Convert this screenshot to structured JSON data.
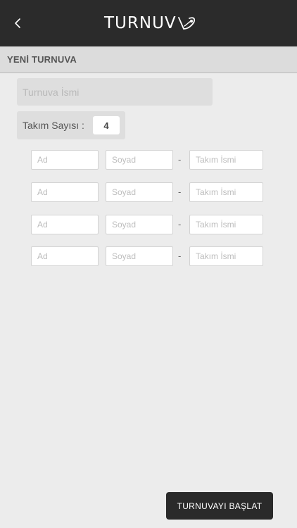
{
  "header": {
    "logo_text": "TURNUV",
    "back_icon": "chevron-left-icon",
    "logo_icon": "ball-swoosh-icon",
    "background_color": "#2b2b2b"
  },
  "section": {
    "title": "YENİ TURNUVA"
  },
  "form": {
    "tournament_name_placeholder": "Turnuva İsmi",
    "team_count_label": "Takım Sayısı :",
    "team_count_value": "4",
    "teams": [
      {
        "first_name_placeholder": "Ad",
        "last_name_placeholder": "Soyad",
        "separator": "-",
        "team_name_placeholder": "Takım İsmi"
      },
      {
        "first_name_placeholder": "Ad",
        "last_name_placeholder": "Soyad",
        "separator": "-",
        "team_name_placeholder": "Takım İsmi"
      },
      {
        "first_name_placeholder": "Ad",
        "last_name_placeholder": "Soyad",
        "separator": "-",
        "team_name_placeholder": "Takım İsmi"
      },
      {
        "first_name_placeholder": "Ad",
        "last_name_placeholder": "Soyad",
        "separator": "-",
        "team_name_placeholder": "Takım İsmi"
      }
    ]
  },
  "actions": {
    "start_label": "TURNUVAYI BAŞLAT"
  }
}
